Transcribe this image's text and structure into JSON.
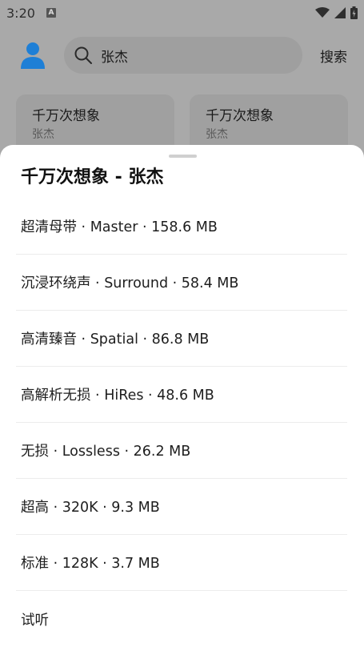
{
  "status_bar": {
    "time": "3:20",
    "notification_icon": "A"
  },
  "header": {
    "search_query": "张杰",
    "search_button": "搜索"
  },
  "results": [
    {
      "title": "千万次想象",
      "artist": "张杰"
    },
    {
      "title": "千万次想象",
      "artist": "张杰"
    }
  ],
  "sheet": {
    "title": "千万次想象 - 张杰",
    "options": [
      "超清母带 · Master · 158.6 MB",
      "沉浸环绕声 · Surround · 58.4 MB",
      "高清臻音 · Spatial · 86.8 MB",
      "高解析无损 · HiRes · 48.6 MB",
      "无损 · Lossless · 26.2 MB",
      "超高 · 320K · 9.3 MB",
      "标准 · 128K · 3.7 MB",
      "试听"
    ]
  },
  "colors": {
    "avatar": "#1e7fd6",
    "scrim": "#a9a9a9",
    "sheet": "#ffffff"
  },
  "icons": [
    "wifi-icon",
    "signal-icon",
    "battery-icon",
    "search-icon",
    "user-avatar-icon"
  ]
}
